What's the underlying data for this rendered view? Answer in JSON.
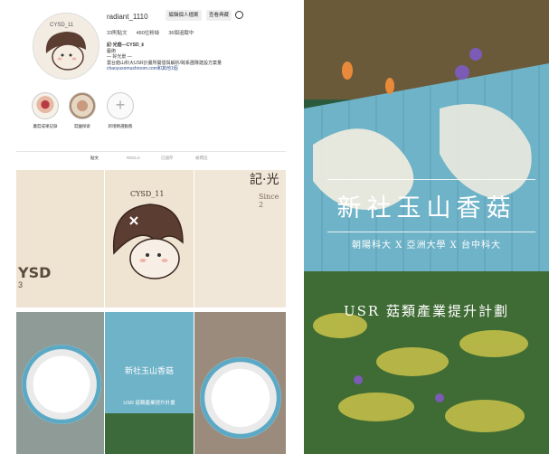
{
  "profile": {
    "username": "radiant_1110",
    "edit_label": "編輯個人檔案",
    "archive_label": "查看典藏",
    "avatar_caption": "CYSD_11",
    "stats": {
      "posts": "33則貼文",
      "followers": "480位粉絲",
      "following": "36個追蹤中"
    },
    "bio": {
      "name": "記·光菇—CYSD_Ⅱ",
      "category": "藝術",
      "line1": "— 好光景 —",
      "line2": "雲台菇山科大USR計畫所開發與解析/跨系團隊建設方案量",
      "link": "chaoyusomushroom.com和其他1個"
    }
  },
  "highlights": [
    {
      "label": "蘑菇成果記錄"
    },
    {
      "label": "菇園探索"
    },
    {
      "label": "新增精選動態"
    }
  ],
  "tabs": [
    {
      "label": "貼文"
    },
    {
      "label": "REELS"
    },
    {
      "label": "已儲存"
    },
    {
      "label": "被標註"
    }
  ],
  "grid": {
    "cell1": {
      "big": "YSD",
      "small": "3"
    },
    "cell2": {
      "caption": "CYSD_11"
    },
    "cell3": {
      "title": "記·光",
      "since": "Since 2"
    },
    "cell5": {
      "title": "新社玉山香菇",
      "band": "USR 菇類產業提升計畫"
    }
  },
  "right_poster": {
    "title": "新社玉山香菇",
    "subtitle": "朝陽科大 X 亞洲大學 X 台中科大",
    "band": "USR 菇類產業提升計劃"
  },
  "colors": {
    "blue_wall": "#6fb3c8",
    "cream": "#efe3d2",
    "foliage": "#2b5a3c"
  }
}
